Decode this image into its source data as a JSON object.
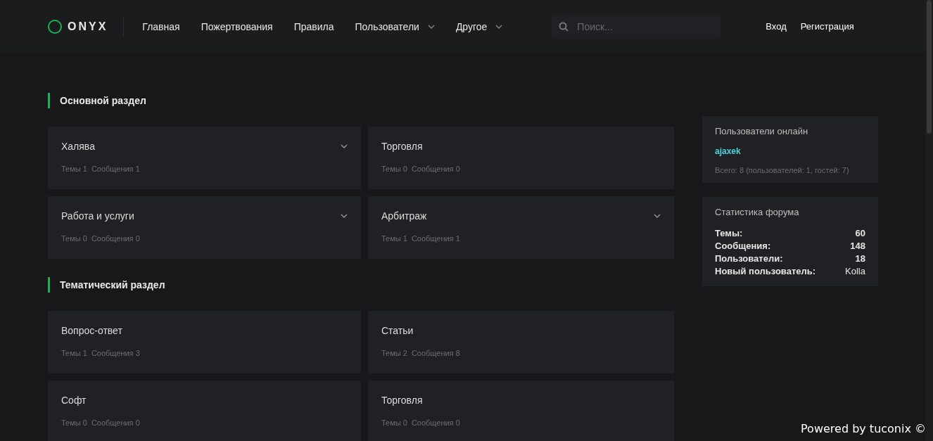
{
  "header": {
    "logo": "ONYX",
    "nav": [
      {
        "label": "Главная",
        "dropdown": false
      },
      {
        "label": "Пожертвования",
        "dropdown": false
      },
      {
        "label": "Правила",
        "dropdown": false
      },
      {
        "label": "Пользователи",
        "dropdown": true
      },
      {
        "label": "Другое",
        "dropdown": true
      }
    ],
    "search": {
      "placeholder": "Поиск..."
    },
    "auth": [
      "Вход",
      "Регистрация"
    ]
  },
  "sections": [
    {
      "title": "Основной раздел",
      "forums": [
        {
          "name": "Халява",
          "has_subforums": true,
          "stats": [
            {
              "label": "Темы",
              "value": "1"
            },
            {
              "label": "Сообщения",
              "value": "1"
            }
          ]
        },
        {
          "name": "Торговля",
          "has_subforums": false,
          "stats": [
            {
              "label": "Темы",
              "value": "0"
            },
            {
              "label": "Сообщения",
              "value": "0"
            }
          ]
        },
        {
          "name": "Работа и услуги",
          "has_subforums": true,
          "stats": [
            {
              "label": "Темы",
              "value": "0"
            },
            {
              "label": "Сообщения",
              "value": "0"
            }
          ]
        },
        {
          "name": "Арбитраж",
          "has_subforums": true,
          "stats": [
            {
              "label": "Темы",
              "value": "1"
            },
            {
              "label": "Сообщения",
              "value": "1"
            }
          ]
        }
      ]
    },
    {
      "title": "Тематический раздел",
      "forums": [
        {
          "name": "Вопрос-ответ",
          "has_subforums": false,
          "stats": [
            {
              "label": "Темы",
              "value": "1"
            },
            {
              "label": "Сообщения",
              "value": "3"
            }
          ]
        },
        {
          "name": "Статьи",
          "has_subforums": false,
          "stats": [
            {
              "label": "Темы",
              "value": "2"
            },
            {
              "label": "Сообщения",
              "value": "8"
            }
          ]
        },
        {
          "name": "Софт",
          "has_subforums": false,
          "stats": [
            {
              "label": "Темы",
              "value": "0"
            },
            {
              "label": "Сообщения",
              "value": "0"
            }
          ]
        },
        {
          "name": "Торговля",
          "has_subforums": false,
          "stats": [
            {
              "label": "Темы",
              "value": "0"
            },
            {
              "label": "Сообщения",
              "value": "0"
            }
          ]
        }
      ]
    }
  ],
  "online": {
    "title": "Пользователи онлайн",
    "users": [
      "ajaxek"
    ],
    "total": "Всего: 8 (пользователей: 1, гостей: 7)"
  },
  "forum_stats": {
    "title": "Статистика форума",
    "rows": [
      {
        "label": "Темы:",
        "value": "60",
        "kind": "count"
      },
      {
        "label": "Сообщения:",
        "value": "148",
        "kind": "count"
      },
      {
        "label": "Пользователи:",
        "value": "18",
        "kind": "count"
      },
      {
        "label": "Новый пользователь:",
        "value": "Kolla",
        "kind": "user"
      }
    ]
  },
  "footer": "Powered by tuconix ©"
}
